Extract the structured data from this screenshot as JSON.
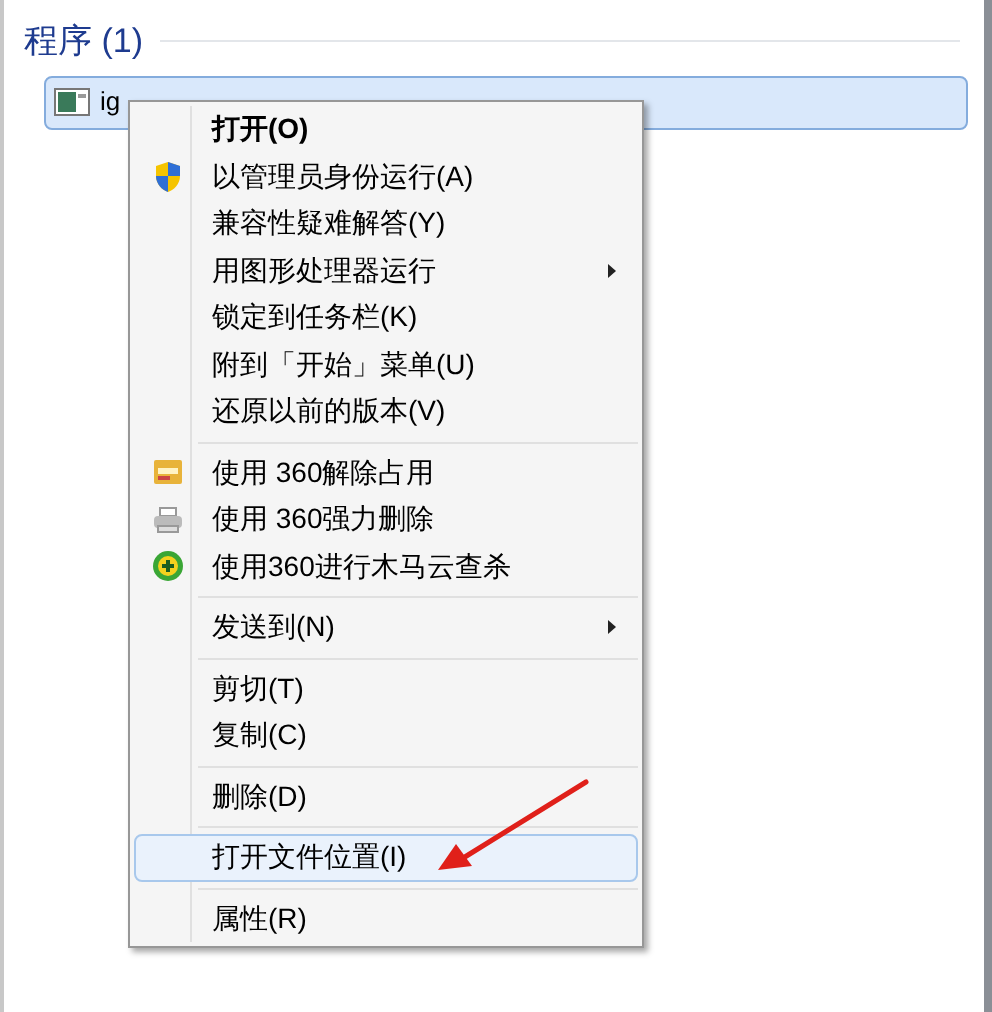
{
  "group": {
    "title": "程序 (1)"
  },
  "program": {
    "name": "ig",
    "selected": true
  },
  "menu": [
    {
      "kind": "item",
      "label": "打开(O)",
      "bold": true,
      "submenu": false,
      "selected": false
    },
    {
      "kind": "item",
      "label": "以管理员身份运行(A)",
      "bold": false,
      "submenu": false,
      "selected": false
    },
    {
      "kind": "item",
      "label": "兼容性疑难解答(Y)",
      "bold": false,
      "submenu": false,
      "selected": false
    },
    {
      "kind": "item",
      "label": "用图形处理器运行",
      "bold": false,
      "submenu": true,
      "selected": false
    },
    {
      "kind": "item",
      "label": "锁定到任务栏(K)",
      "bold": false,
      "submenu": false,
      "selected": false
    },
    {
      "kind": "item",
      "label": "附到「开始」菜单(U)",
      "bold": false,
      "submenu": false,
      "selected": false
    },
    {
      "kind": "item",
      "label": "还原以前的版本(V)",
      "bold": false,
      "submenu": false,
      "selected": false
    },
    {
      "kind": "separator"
    },
    {
      "kind": "item",
      "label": "使用 360解除占用",
      "bold": false,
      "submenu": false,
      "selected": false
    },
    {
      "kind": "item",
      "label": "使用 360强力删除",
      "bold": false,
      "submenu": false,
      "selected": false
    },
    {
      "kind": "item",
      "label": "使用360进行木马云查杀",
      "bold": false,
      "submenu": false,
      "selected": false
    },
    {
      "kind": "separator"
    },
    {
      "kind": "item",
      "label": "发送到(N)",
      "bold": false,
      "submenu": true,
      "selected": false
    },
    {
      "kind": "separator"
    },
    {
      "kind": "item",
      "label": "剪切(T)",
      "bold": false,
      "submenu": false,
      "selected": false
    },
    {
      "kind": "item",
      "label": "复制(C)",
      "bold": false,
      "submenu": false,
      "selected": false
    },
    {
      "kind": "separator"
    },
    {
      "kind": "item",
      "label": "删除(D)",
      "bold": false,
      "submenu": false,
      "selected": false
    },
    {
      "kind": "separator"
    },
    {
      "kind": "item",
      "label": "打开文件位置(I)",
      "bold": false,
      "submenu": false,
      "selected": true
    },
    {
      "kind": "separator"
    },
    {
      "kind": "item",
      "label": "属性(R)",
      "bold": false,
      "submenu": false,
      "selected": false
    }
  ]
}
